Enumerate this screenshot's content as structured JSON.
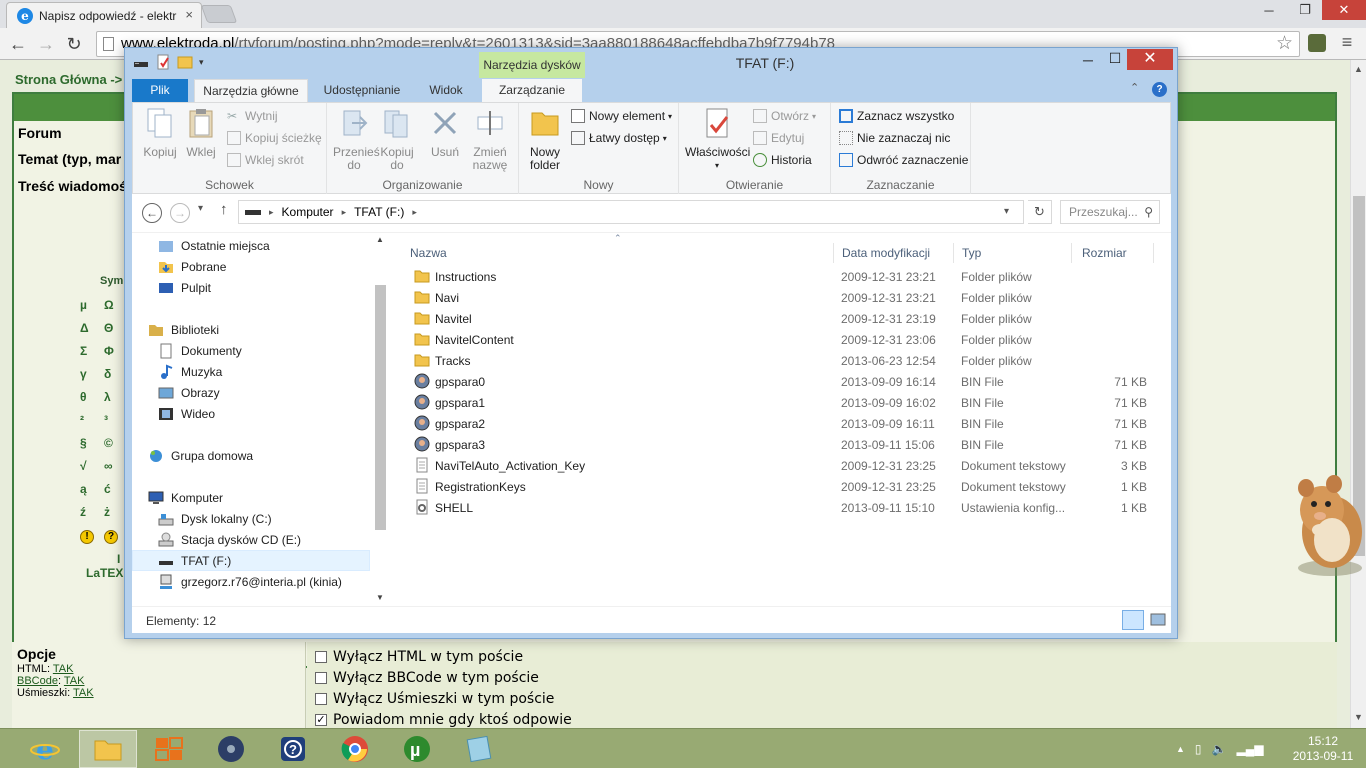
{
  "browser": {
    "tab_title": "Napisz odpowiedź - elektr",
    "tab_close": "×",
    "url_domain": "www.elektroda.pl",
    "url_path": "/rtvforum/posting.php?mode=reply&t=2601313&sid=3aa880188648acffebdba7b9f7794b78",
    "win_min": "─",
    "win_max": "❐",
    "win_close": "✕"
  },
  "forum": {
    "breadcrumb": "Strona Główna ->",
    "rows": [
      "Forum",
      "Temat (typ, mar",
      "Treść wiadomoś"
    ],
    "sym_header": "Sym",
    "sym_col1": [
      "µ",
      "Δ",
      "Σ",
      "γ",
      "θ",
      "²",
      "§",
      "√",
      "ą",
      "ź"
    ],
    "sym_col2": [
      "Ω",
      "Θ",
      "Φ",
      "δ",
      "λ",
      "³",
      "©",
      "∞",
      "ć",
      "ż"
    ],
    "latex": "LaTEX",
    "i_label": "I",
    "options_title": "Opcje",
    "html_label": "HTML: ",
    "html_value": "TAK",
    "bbcode_label": "BBCode",
    "bbcode_value": "TAK",
    "smilies_label": "Uśmieszki: ",
    "smilies_value": "TAK",
    "checkboxes": [
      {
        "label": "Wyłącz HTML w tym poście",
        "checked": false
      },
      {
        "label": "Wyłącz BBCode w tym poście",
        "checked": false
      },
      {
        "label": "Wyłącz Uśmieszki w tym poście",
        "checked": false
      },
      {
        "label": "Powiadom mnie gdy ktoś odpowie",
        "checked": true
      }
    ]
  },
  "explorer": {
    "context_tab": "Narzędzia dysków",
    "title": "TFAT (F:)",
    "tabs": {
      "file": "Plik",
      "home": "Narzędzia główne",
      "share": "Udostępnianie",
      "view": "Widok",
      "manage": "Zarządzanie"
    },
    "ribbon": {
      "copy": "Kopiuj",
      "paste": "Wklej",
      "cut": "Wytnij",
      "copy_path": "Kopiuj ścieżkę",
      "paste_shortcut": "Wklej skrót",
      "group_clipboard": "Schowek",
      "move_to": "Przenieś\ndo",
      "copy_to": "Kopiuj\ndo",
      "delete": "Usuń",
      "rename": "Zmień\nnazwę",
      "group_organize": "Organizowanie",
      "new_folder": "Nowy\nfolder",
      "new_item": "Nowy element",
      "easy_access": "Łatwy dostęp",
      "group_new": "Nowy",
      "properties": "Właściwości",
      "open": "Otwórz",
      "edit": "Edytuj",
      "history": "Historia",
      "group_open": "Otwieranie",
      "select_all": "Zaznacz wszystko",
      "select_none": "Nie zaznaczaj nic",
      "invert_selection": "Odwróć zaznaczenie",
      "group_select": "Zaznaczanie"
    },
    "address": {
      "crumbs": [
        "Komputer",
        "TFAT (F:)"
      ],
      "search_placeholder": "Przeszukaj..."
    },
    "nav_items": [
      {
        "label": "Ostatnie miejsca",
        "icon": "recent-places-icon"
      },
      {
        "label": "Pobrane",
        "icon": "downloads-icon"
      },
      {
        "label": "Pulpit",
        "icon": "desktop-icon"
      },
      {
        "label": "Biblioteki",
        "icon": "libraries-icon"
      },
      {
        "label": "Dokumenty",
        "icon": "documents-icon"
      },
      {
        "label": "Muzyka",
        "icon": "music-icon"
      },
      {
        "label": "Obrazy",
        "icon": "pictures-icon"
      },
      {
        "label": "Wideo",
        "icon": "video-icon"
      },
      {
        "label": "Grupa domowa",
        "icon": "homegroup-icon"
      },
      {
        "label": "Komputer",
        "icon": "computer-icon"
      },
      {
        "label": "Dysk lokalny (C:)",
        "icon": "local-disk-icon"
      },
      {
        "label": "Stacja dysków CD (E:)",
        "icon": "cd-drive-icon"
      },
      {
        "label": "TFAT (F:)",
        "icon": "usb-drive-icon"
      },
      {
        "label": "grzegorz.r76@interia.pl (kinia)",
        "icon": "network-drive-icon"
      }
    ],
    "columns": {
      "name": "Nazwa",
      "date": "Data modyfikacji",
      "type": "Typ",
      "size": "Rozmiar"
    },
    "files": [
      {
        "name": "Instructions",
        "date": "2009-12-31 23:21",
        "type": "Folder plików",
        "size": "",
        "icon": "folder-icon"
      },
      {
        "name": "Navi",
        "date": "2009-12-31 23:21",
        "type": "Folder plików",
        "size": "",
        "icon": "folder-icon"
      },
      {
        "name": "Navitel",
        "date": "2009-12-31 23:19",
        "type": "Folder plików",
        "size": "",
        "icon": "folder-icon"
      },
      {
        "name": "NavitelContent",
        "date": "2009-12-31 23:06",
        "type": "Folder plików",
        "size": "",
        "icon": "folder-icon"
      },
      {
        "name": "Tracks",
        "date": "2013-06-23 12:54",
        "type": "Folder plików",
        "size": "",
        "icon": "folder-icon"
      },
      {
        "name": "gpspara0",
        "date": "2013-09-09 16:14",
        "type": "BIN File",
        "size": "71 KB",
        "icon": "bin-file-icon"
      },
      {
        "name": "gpspara1",
        "date": "2013-09-09 16:02",
        "type": "BIN File",
        "size": "71 KB",
        "icon": "bin-file-icon"
      },
      {
        "name": "gpspara2",
        "date": "2013-09-09 16:11",
        "type": "BIN File",
        "size": "71 KB",
        "icon": "bin-file-icon"
      },
      {
        "name": "gpspara3",
        "date": "2013-09-11 15:06",
        "type": "BIN File",
        "size": "71 KB",
        "icon": "bin-file-icon"
      },
      {
        "name": "NaviTelAuto_Activation_Key",
        "date": "2009-12-31 23:25",
        "type": "Dokument tekstowy",
        "size": "3 KB",
        "icon": "text-file-icon"
      },
      {
        "name": "RegistrationKeys",
        "date": "2009-12-31 23:25",
        "type": "Dokument tekstowy",
        "size": "1 KB",
        "icon": "text-file-icon"
      },
      {
        "name": "SHELL",
        "date": "2013-09-11 15:10",
        "type": "Ustawienia konfig...",
        "size": "1 KB",
        "icon": "config-file-icon"
      }
    ],
    "status": "Elementy: 12"
  },
  "taskbar": {
    "items": [
      {
        "name": "internet-explorer",
        "icon": "ie-icon",
        "active": false
      },
      {
        "name": "file-explorer",
        "icon": "folder-icon",
        "active": true
      },
      {
        "name": "office",
        "icon": "office-icon",
        "active": false
      },
      {
        "name": "media-app",
        "icon": "disc-icon",
        "active": false
      },
      {
        "name": "help",
        "icon": "help-icon",
        "active": false
      },
      {
        "name": "chrome",
        "icon": "chrome-icon",
        "active": false
      },
      {
        "name": "utorrent",
        "icon": "utorrent-icon",
        "active": false
      },
      {
        "name": "notes",
        "icon": "notes-icon",
        "active": false
      }
    ],
    "time": "15:12",
    "date": "2013-09-11"
  }
}
